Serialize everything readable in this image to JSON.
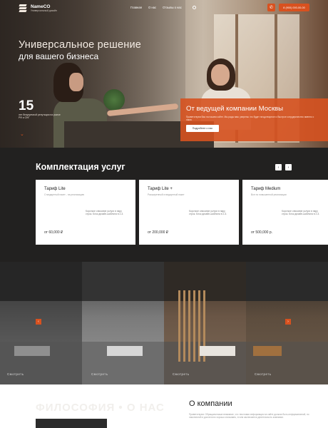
{
  "header": {
    "brand_name": "NameCO",
    "brand_tagline": "Универсальный дизайн",
    "nav": [
      "Главная",
      "О нас",
      "Отзывы о нас"
    ],
    "phone": "8 (900) 000-00-00",
    "accent_color": "#d8511f"
  },
  "hero": {
    "title": "Универсальное решение",
    "subtitle": "для вашего бизнеса",
    "stat_number": "15",
    "stat_text": "лет безупречной репутации на рынке РФ и СНГ",
    "promo_title": "От ведущей компании Москвы",
    "promo_text": "Приветствуем Вас на нашем сайте. Мы рады вам, уверены что будет плодотворное и быстрое сотрудничество именно с нами.",
    "promo_button": "Подробнее о нас"
  },
  "services": {
    "title": "Комплектация услуг",
    "cards": [
      {
        "name": "Тариф Lite",
        "small": "Стандартный пакет - на реализацию",
        "desc": "Короткое описание услуги в пару строк. Блок дизайн-шаблона в 2-3.",
        "price": "от 60,000 ₽"
      },
      {
        "name": "Тариф Lite +",
        "small": "Расширенный стандартный пакет",
        "desc": "Короткое описание услуги в пару строк. Блок дизайн-шаблона в 2-3.",
        "price": "от 200,000 ₽"
      },
      {
        "name": "Тариф Medium",
        "small": "Все по повышенной реализации",
        "desc": "Короткое описание услуги в пару строк. Блок дизайн-шаблона в 2-3.",
        "price": "от 500,000 р."
      }
    ]
  },
  "gallery": {
    "captions": [
      "Смотреть",
      "Смотреть",
      "Смотреть",
      "Смотреть"
    ]
  },
  "about": {
    "ghost_text": "ФИЛОСОФИЯ • О НАС",
    "title": "О компании",
    "text": "Приветствуем. Обращаем ваше внимание, что текстовая информация на сайте должна быть информативной, но лаконичной и достаточно хорошо описывать, в чем заключается деятельность компании."
  }
}
